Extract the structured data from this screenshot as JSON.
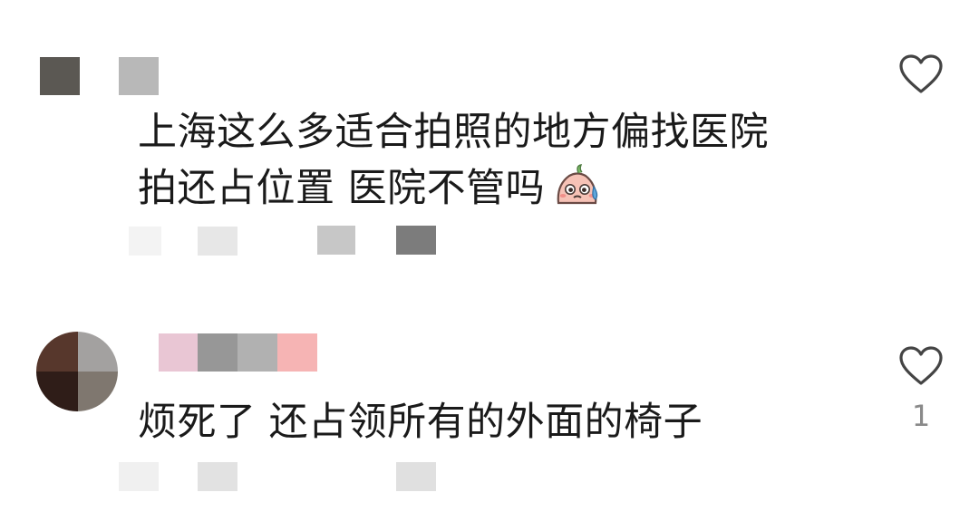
{
  "comments": [
    {
      "lines": [
        "上海这么多适合拍照的地方偏找医院",
        "拍还占位置 医院不管吗"
      ],
      "emoji": "sweat-face-emoji",
      "likes": ""
    },
    {
      "lines": [
        "烦死了 还占领所有的外面的椅子"
      ],
      "likes": "1"
    }
  ],
  "icons": {
    "like": "heart-outline-icon"
  },
  "colors": {
    "text": "#1a1a1a",
    "like_count": "#8a8a8a",
    "heart_stroke": "#444444"
  }
}
